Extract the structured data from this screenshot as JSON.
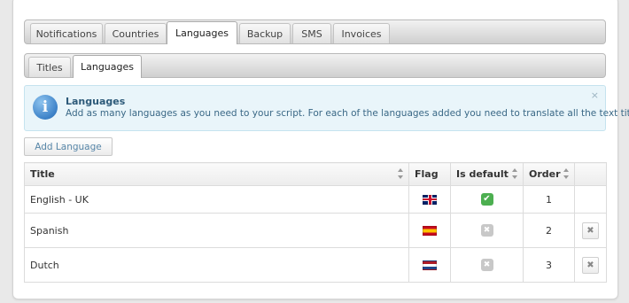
{
  "main_tabs": [
    "Notifications",
    "Countries",
    "Languages",
    "Backup",
    "SMS",
    "Invoices"
  ],
  "main_active": "Languages",
  "sub_tabs": [
    "Titles",
    "Languages"
  ],
  "sub_active": "Languages",
  "info": {
    "title": "Languages",
    "text": "Add as many languages as you need to your script. For each of the languages added you need to translate all the text titles.",
    "close_glyph": "×",
    "icon_glyph": "i"
  },
  "add_button": "Add Language",
  "table": {
    "columns": [
      "Title",
      "Flag",
      "Is default",
      "Order",
      ""
    ],
    "rows": [
      {
        "title": "English - UK",
        "flag": "flag-uk",
        "is_default": true,
        "order": "1",
        "deletable": false
      },
      {
        "title": "Spanish",
        "flag": "flag-es",
        "is_default": false,
        "order": "2",
        "deletable": true
      },
      {
        "title": "Dutch",
        "flag": "flag-nl",
        "is_default": false,
        "order": "3",
        "deletable": true
      }
    ]
  },
  "colors": {
    "accent": "#3d82c8",
    "ok": "#4caf50",
    "info_bg": "#e9f5fa"
  }
}
